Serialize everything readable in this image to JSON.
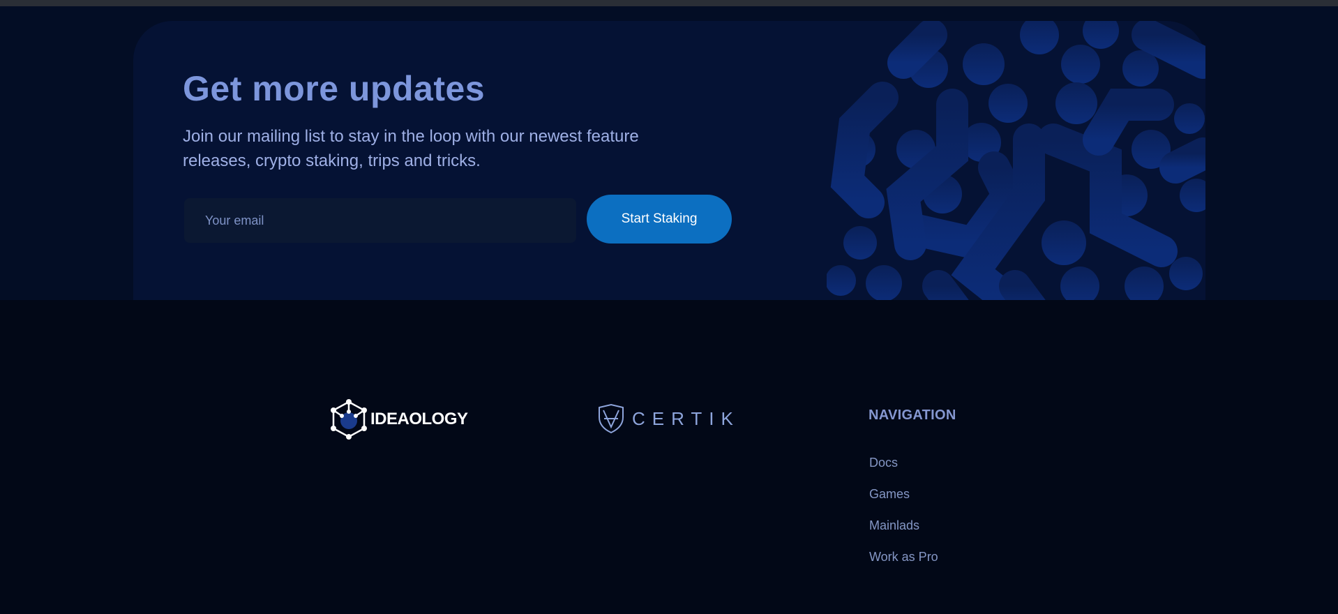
{
  "newsletter": {
    "title": "Get more updates",
    "description": "Join our mailing list to stay in the loop with our newest feature releases, crypto staking, trips and tricks.",
    "email_placeholder": "Your email",
    "button_label": "Start Staking"
  },
  "footer": {
    "partners": [
      {
        "name": "IDEAOLOGY",
        "icon": "ideaology-logo-icon"
      },
      {
        "name": "CERTIK",
        "icon": "certik-shield-icon"
      }
    ],
    "navigation": {
      "heading": "NAVIGATION",
      "items": [
        {
          "label": "Docs"
        },
        {
          "label": "Games"
        },
        {
          "label": "Mainlads"
        },
        {
          "label": "Work as Pro"
        }
      ]
    }
  },
  "colors": {
    "accent": "#0c6fc1",
    "heading": "#7d96dc",
    "pattern": "#0d2a6e"
  }
}
